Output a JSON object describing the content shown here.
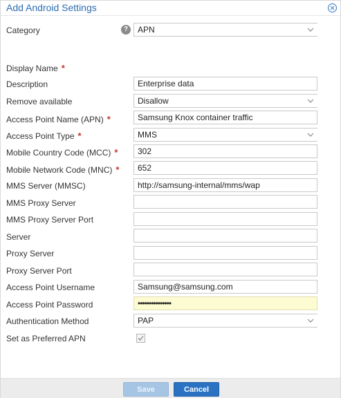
{
  "dialog": {
    "title": "Add Android Settings",
    "close_icon": "close-circle-icon"
  },
  "category": {
    "label": "Category",
    "value": "APN",
    "help_icon": "question-circle-icon"
  },
  "form": {
    "display_name": {
      "label": "Display Name",
      "required": "*"
    },
    "description": {
      "label": "Description",
      "value": "Enterprise data"
    },
    "remove_available": {
      "label": "Remove available",
      "value": "Disallow"
    },
    "apn": {
      "label": "Access Point Name (APN)",
      "required": "*",
      "value": "Samsung Knox container traffic"
    },
    "apn_type": {
      "label": "Access Point Type",
      "required": "*",
      "value": "MMS"
    },
    "mcc": {
      "label": "Mobile Country Code (MCC)",
      "required": "*",
      "value": "302"
    },
    "mnc": {
      "label": "Mobile Network Code (MNC)",
      "required": "*",
      "value": "652"
    },
    "mmsc": {
      "label": "MMS Server (MMSC)",
      "value": "http://samsung-internal/mms/wap"
    },
    "mms_proxy_server": {
      "label": "MMS Proxy Server",
      "value": ""
    },
    "mms_proxy_port": {
      "label": "MMS Proxy Server Port",
      "value": ""
    },
    "server": {
      "label": "Server",
      "value": ""
    },
    "proxy_server": {
      "label": "Proxy Server",
      "value": ""
    },
    "proxy_port": {
      "label": "Proxy Server Port",
      "value": ""
    },
    "ap_username": {
      "label": "Access Point Username",
      "value": "Samsung@samsung.com"
    },
    "ap_password": {
      "label": "Access Point Password",
      "value": "•••••••••••••••"
    },
    "auth_method": {
      "label": "Authentication Method",
      "value": "PAP"
    },
    "preferred_apn": {
      "label": "Set as Preferred APN",
      "checked": true
    }
  },
  "footer": {
    "save_label": "Save",
    "cancel_label": "Cancel"
  },
  "colors": {
    "title": "#2b6cb0",
    "required": "#c0392b",
    "password_bg": "#fcfbd1",
    "save_button": "#a6c4e3",
    "cancel_button": "#2b73c2"
  }
}
